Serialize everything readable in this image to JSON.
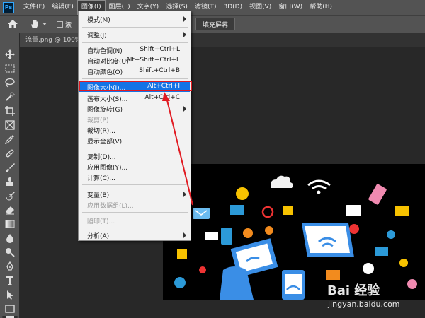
{
  "app": {
    "logo_text": "Ps"
  },
  "menubar": {
    "items": [
      {
        "label": "文件(F)"
      },
      {
        "label": "编辑(E)"
      },
      {
        "label": "图像(I)"
      },
      {
        "label": "图层(L)"
      },
      {
        "label": "文字(Y)"
      },
      {
        "label": "选择(S)"
      },
      {
        "label": "滤镜(T)"
      },
      {
        "label": "3D(D)"
      },
      {
        "label": "视图(V)"
      },
      {
        "label": "窗口(W)"
      },
      {
        "label": "帮助(H)"
      }
    ],
    "active_index": 2
  },
  "optionsbar": {
    "scroll_partial_text": "滚",
    "fill_screen_label": "填充屏幕"
  },
  "document": {
    "tab_title": "流量.png @ 100%"
  },
  "image_menu": {
    "items": [
      {
        "label": "模式(M)",
        "shortcut": "",
        "submenu": true,
        "disabled": false
      },
      {
        "label": "调整(J)",
        "shortcut": "",
        "submenu": true,
        "disabled": false
      },
      {
        "label": "自动色调(N)",
        "shortcut": "Shift+Ctrl+L",
        "submenu": false,
        "disabled": false
      },
      {
        "label": "自动对比度(U)",
        "shortcut": "Alt+Shift+Ctrl+L",
        "submenu": false,
        "disabled": false
      },
      {
        "label": "自动颜色(O)",
        "shortcut": "Shift+Ctrl+B",
        "submenu": false,
        "disabled": false
      },
      {
        "label": "图像大小(I)...",
        "shortcut": "Alt+Ctrl+I",
        "submenu": false,
        "disabled": false,
        "highlighted": true
      },
      {
        "label": "画布大小(S)...",
        "shortcut": "Alt+Ctrl+C",
        "submenu": false,
        "disabled": false
      },
      {
        "label": "图像旋转(G)",
        "shortcut": "",
        "submenu": true,
        "disabled": false
      },
      {
        "label": "裁剪(P)",
        "shortcut": "",
        "submenu": false,
        "disabled": true
      },
      {
        "label": "裁切(R)...",
        "shortcut": "",
        "submenu": false,
        "disabled": false
      },
      {
        "label": "显示全部(V)",
        "shortcut": "",
        "submenu": false,
        "disabled": false
      },
      {
        "label": "复制(D)...",
        "shortcut": "",
        "submenu": false,
        "disabled": false
      },
      {
        "label": "应用图像(Y)...",
        "shortcut": "",
        "submenu": false,
        "disabled": false
      },
      {
        "label": "计算(C)...",
        "shortcut": "",
        "submenu": false,
        "disabled": false
      },
      {
        "label": "变量(B)",
        "shortcut": "",
        "submenu": true,
        "disabled": false
      },
      {
        "label": "应用数据组(L)...",
        "shortcut": "",
        "submenu": false,
        "disabled": true
      },
      {
        "label": "陷印(T)...",
        "shortcut": "",
        "submenu": false,
        "disabled": true
      },
      {
        "label": "分析(A)",
        "shortcut": "",
        "submenu": true,
        "disabled": false
      }
    ]
  },
  "tools": [
    "move-icon",
    "marquee-icon",
    "lasso-icon",
    "quick-select-icon",
    "crop-icon",
    "frame-icon",
    "eyedropper-icon",
    "healing-icon",
    "brush-icon",
    "stamp-icon",
    "history-brush-icon",
    "eraser-icon",
    "gradient-icon",
    "blur-icon",
    "dodge-icon",
    "pen-icon",
    "type-icon",
    "path-select-icon",
    "rectangle-icon",
    "hand-icon"
  ],
  "watermark": {
    "brand": "Bai 经验",
    "url": "jingyan.baidu.com"
  },
  "colors": {
    "highlight": "#1473e6",
    "annotation_red": "#e11b22",
    "panel": "#535353",
    "workspace": "#282828"
  }
}
